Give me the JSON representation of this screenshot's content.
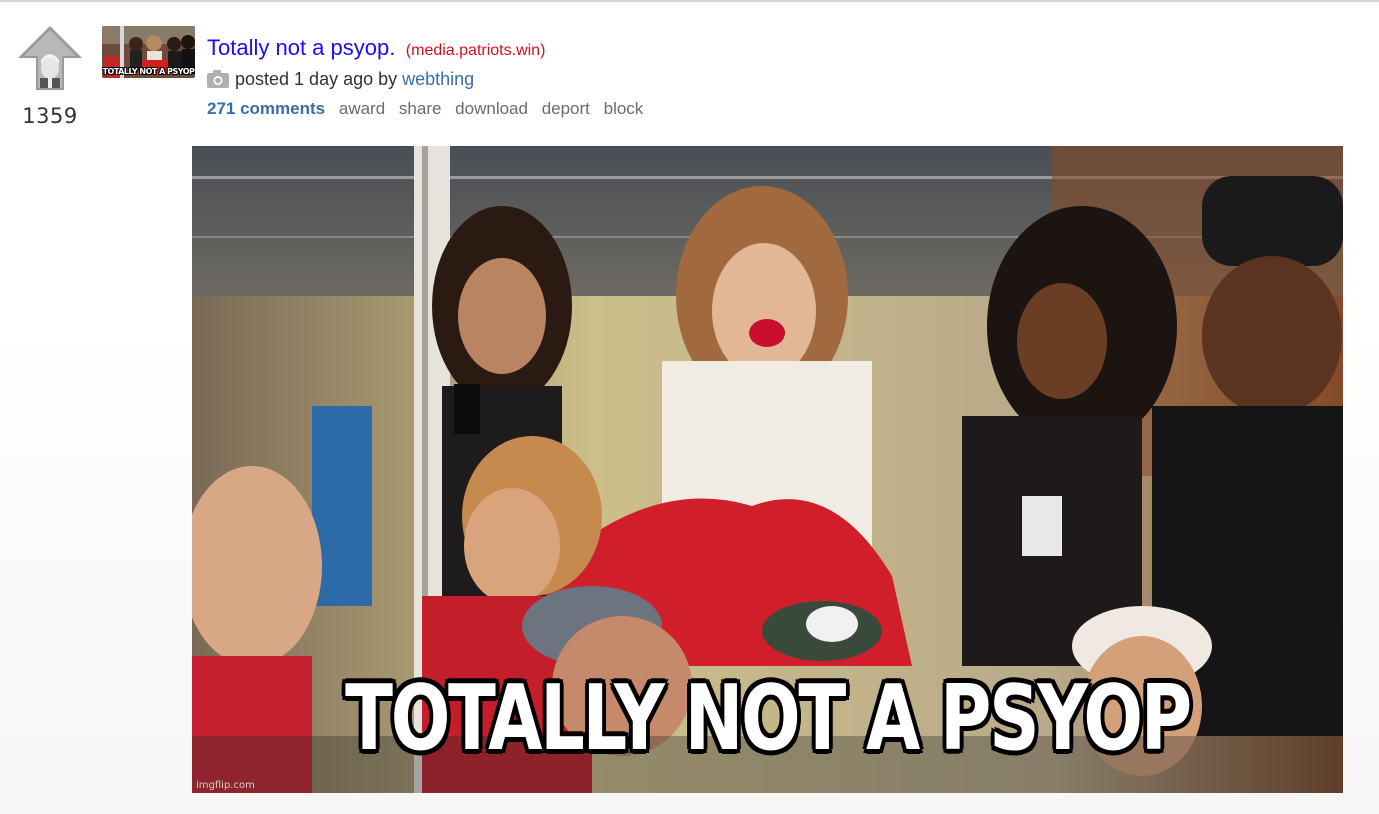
{
  "vote": {
    "score": "1359",
    "icon": "upvote-arrow-icon"
  },
  "post": {
    "title": "Totally not a psyop.",
    "domain": "(media.patriots.win)",
    "posted_prefix": "posted 1 day ago by",
    "author": "webthing",
    "media_icon": "camera-icon"
  },
  "actions": {
    "comments": "271 comments",
    "award": "award",
    "share": "share",
    "download": "download",
    "deport": "deport",
    "block": "block"
  },
  "image": {
    "caption": "TOTALLY NOT A PSYOP",
    "watermark": "imgflip.com"
  },
  "thumbnail": {
    "caption": "TOTALLY NOT A PSYOP"
  },
  "colors": {
    "title_link": "#1a0dff",
    "domain": "#d0131d",
    "author_link": "#3b6ea8",
    "action_text": "#6b6b6b"
  }
}
